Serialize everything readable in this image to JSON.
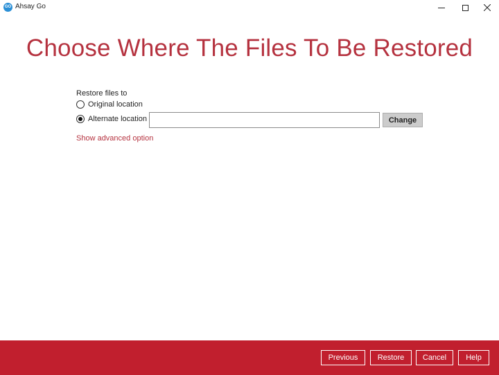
{
  "window": {
    "logo_text": "GO",
    "title": "Ahsay Go"
  },
  "page": {
    "title": "Choose Where The Files To Be Restored"
  },
  "restore": {
    "label": "Restore files to",
    "original_label": "Original location",
    "alternate_label": "Alternate location",
    "selected": "alternate",
    "location_value": "",
    "change_label": "Change",
    "advanced_link": "Show advanced option"
  },
  "footer": {
    "previous_label": "Previous",
    "restore_label": "Restore",
    "cancel_label": "Cancel",
    "help_label": "Help"
  },
  "colors": {
    "accent": "#b5323f",
    "footer_bg": "#c11f2e"
  }
}
